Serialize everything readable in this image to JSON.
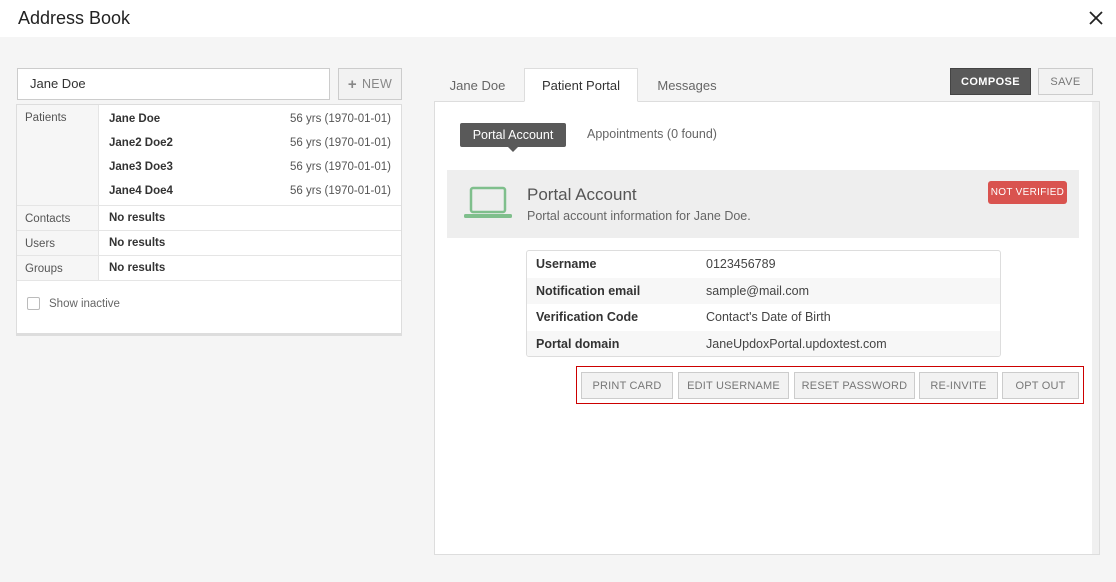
{
  "window": {
    "title": "Address Book"
  },
  "search": {
    "value": "Jane Doe"
  },
  "new_button": {
    "label": "NEW"
  },
  "results": {
    "groups": [
      {
        "label": "Patients",
        "rows": [
          {
            "name": "Jane Doe",
            "meta": "56 yrs (1970-01-01)"
          },
          {
            "name": "Jane2 Doe2",
            "meta": "56 yrs (1970-01-01)"
          },
          {
            "name": "Jane3 Doe3",
            "meta": "56 yrs (1970-01-01)"
          },
          {
            "name": "Jane4 Doe4",
            "meta": "56 yrs (1970-01-01)"
          }
        ]
      },
      {
        "label": "Contacts",
        "empty": "No results"
      },
      {
        "label": "Users",
        "empty": "No results"
      },
      {
        "label": "Groups",
        "empty": "No results"
      }
    ],
    "show_inactive": {
      "label": "Show inactive",
      "checked": false
    }
  },
  "tabs": [
    {
      "label": "Jane Doe",
      "active": false
    },
    {
      "label": "Patient Portal",
      "active": true
    },
    {
      "label": "Messages",
      "active": false
    }
  ],
  "toolbar": {
    "compose_label": "COMPOSE",
    "save_label": "SAVE"
  },
  "subtabs": {
    "active": "Portal Account",
    "other": "Appointments (0 found)"
  },
  "account_card": {
    "title": "Portal Account",
    "subtitle": "Portal account information for Jane Doe.",
    "status": "NOT VERIFIED",
    "status_color": "#d9534f",
    "icon": "laptop-icon",
    "icon_color": "#7fbf8c"
  },
  "info": [
    {
      "label": "Username",
      "value": "0123456789"
    },
    {
      "label": "Notification email",
      "value": "sample@mail.com"
    },
    {
      "label": "Verification Code",
      "value": "Contact's Date of Birth"
    },
    {
      "label": "Portal domain",
      "value": "JaneUpdoxPortal.updoxtest.com"
    }
  ],
  "actions": {
    "print_card": "PRINT CARD",
    "edit_username": "EDIT USERNAME",
    "reset_password": "RESET PASSWORD",
    "re_invite": "RE-INVITE",
    "opt_out": "OPT OUT"
  }
}
